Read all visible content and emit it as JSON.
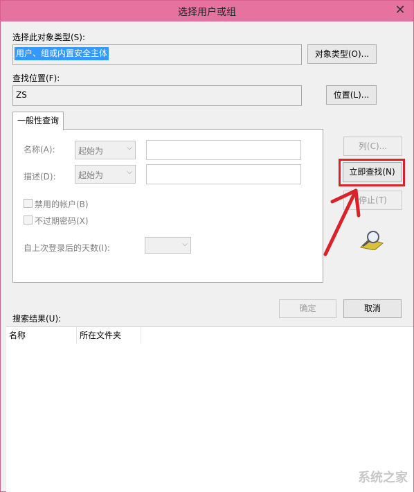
{
  "window": {
    "title": "选择用户或组",
    "close_glyph": "✕"
  },
  "object_type": {
    "label": "选择此对象类型(S):",
    "value": "用户、组或内置安全主体",
    "button": "对象类型(O)..."
  },
  "location": {
    "label": "查找位置(F):",
    "value": "ZS",
    "button": "位置(L)..."
  },
  "query": {
    "tab_label": "一般性查询",
    "name_label": "名称(A):",
    "name_mode": "起始为",
    "desc_label": "描述(D):",
    "desc_mode": "起始为",
    "disabled_accounts": "禁用的帐户(B)",
    "non_expiring": "不过期密码(X)",
    "days_label": "自上次登录后的天数(I):"
  },
  "side_buttons": {
    "columns": "列(C)...",
    "find_now": "立即查找(N)",
    "stop": "停止(T)"
  },
  "footer": {
    "ok": "确定",
    "cancel": "取消"
  },
  "results": {
    "label": "搜索结果(U):",
    "columns": [
      "名称",
      "所在文件夹"
    ]
  },
  "watermark": "系统之家",
  "colors": {
    "titlebar": "#e6739f",
    "highlight": "#d9232a",
    "selection": "#3399ff"
  }
}
